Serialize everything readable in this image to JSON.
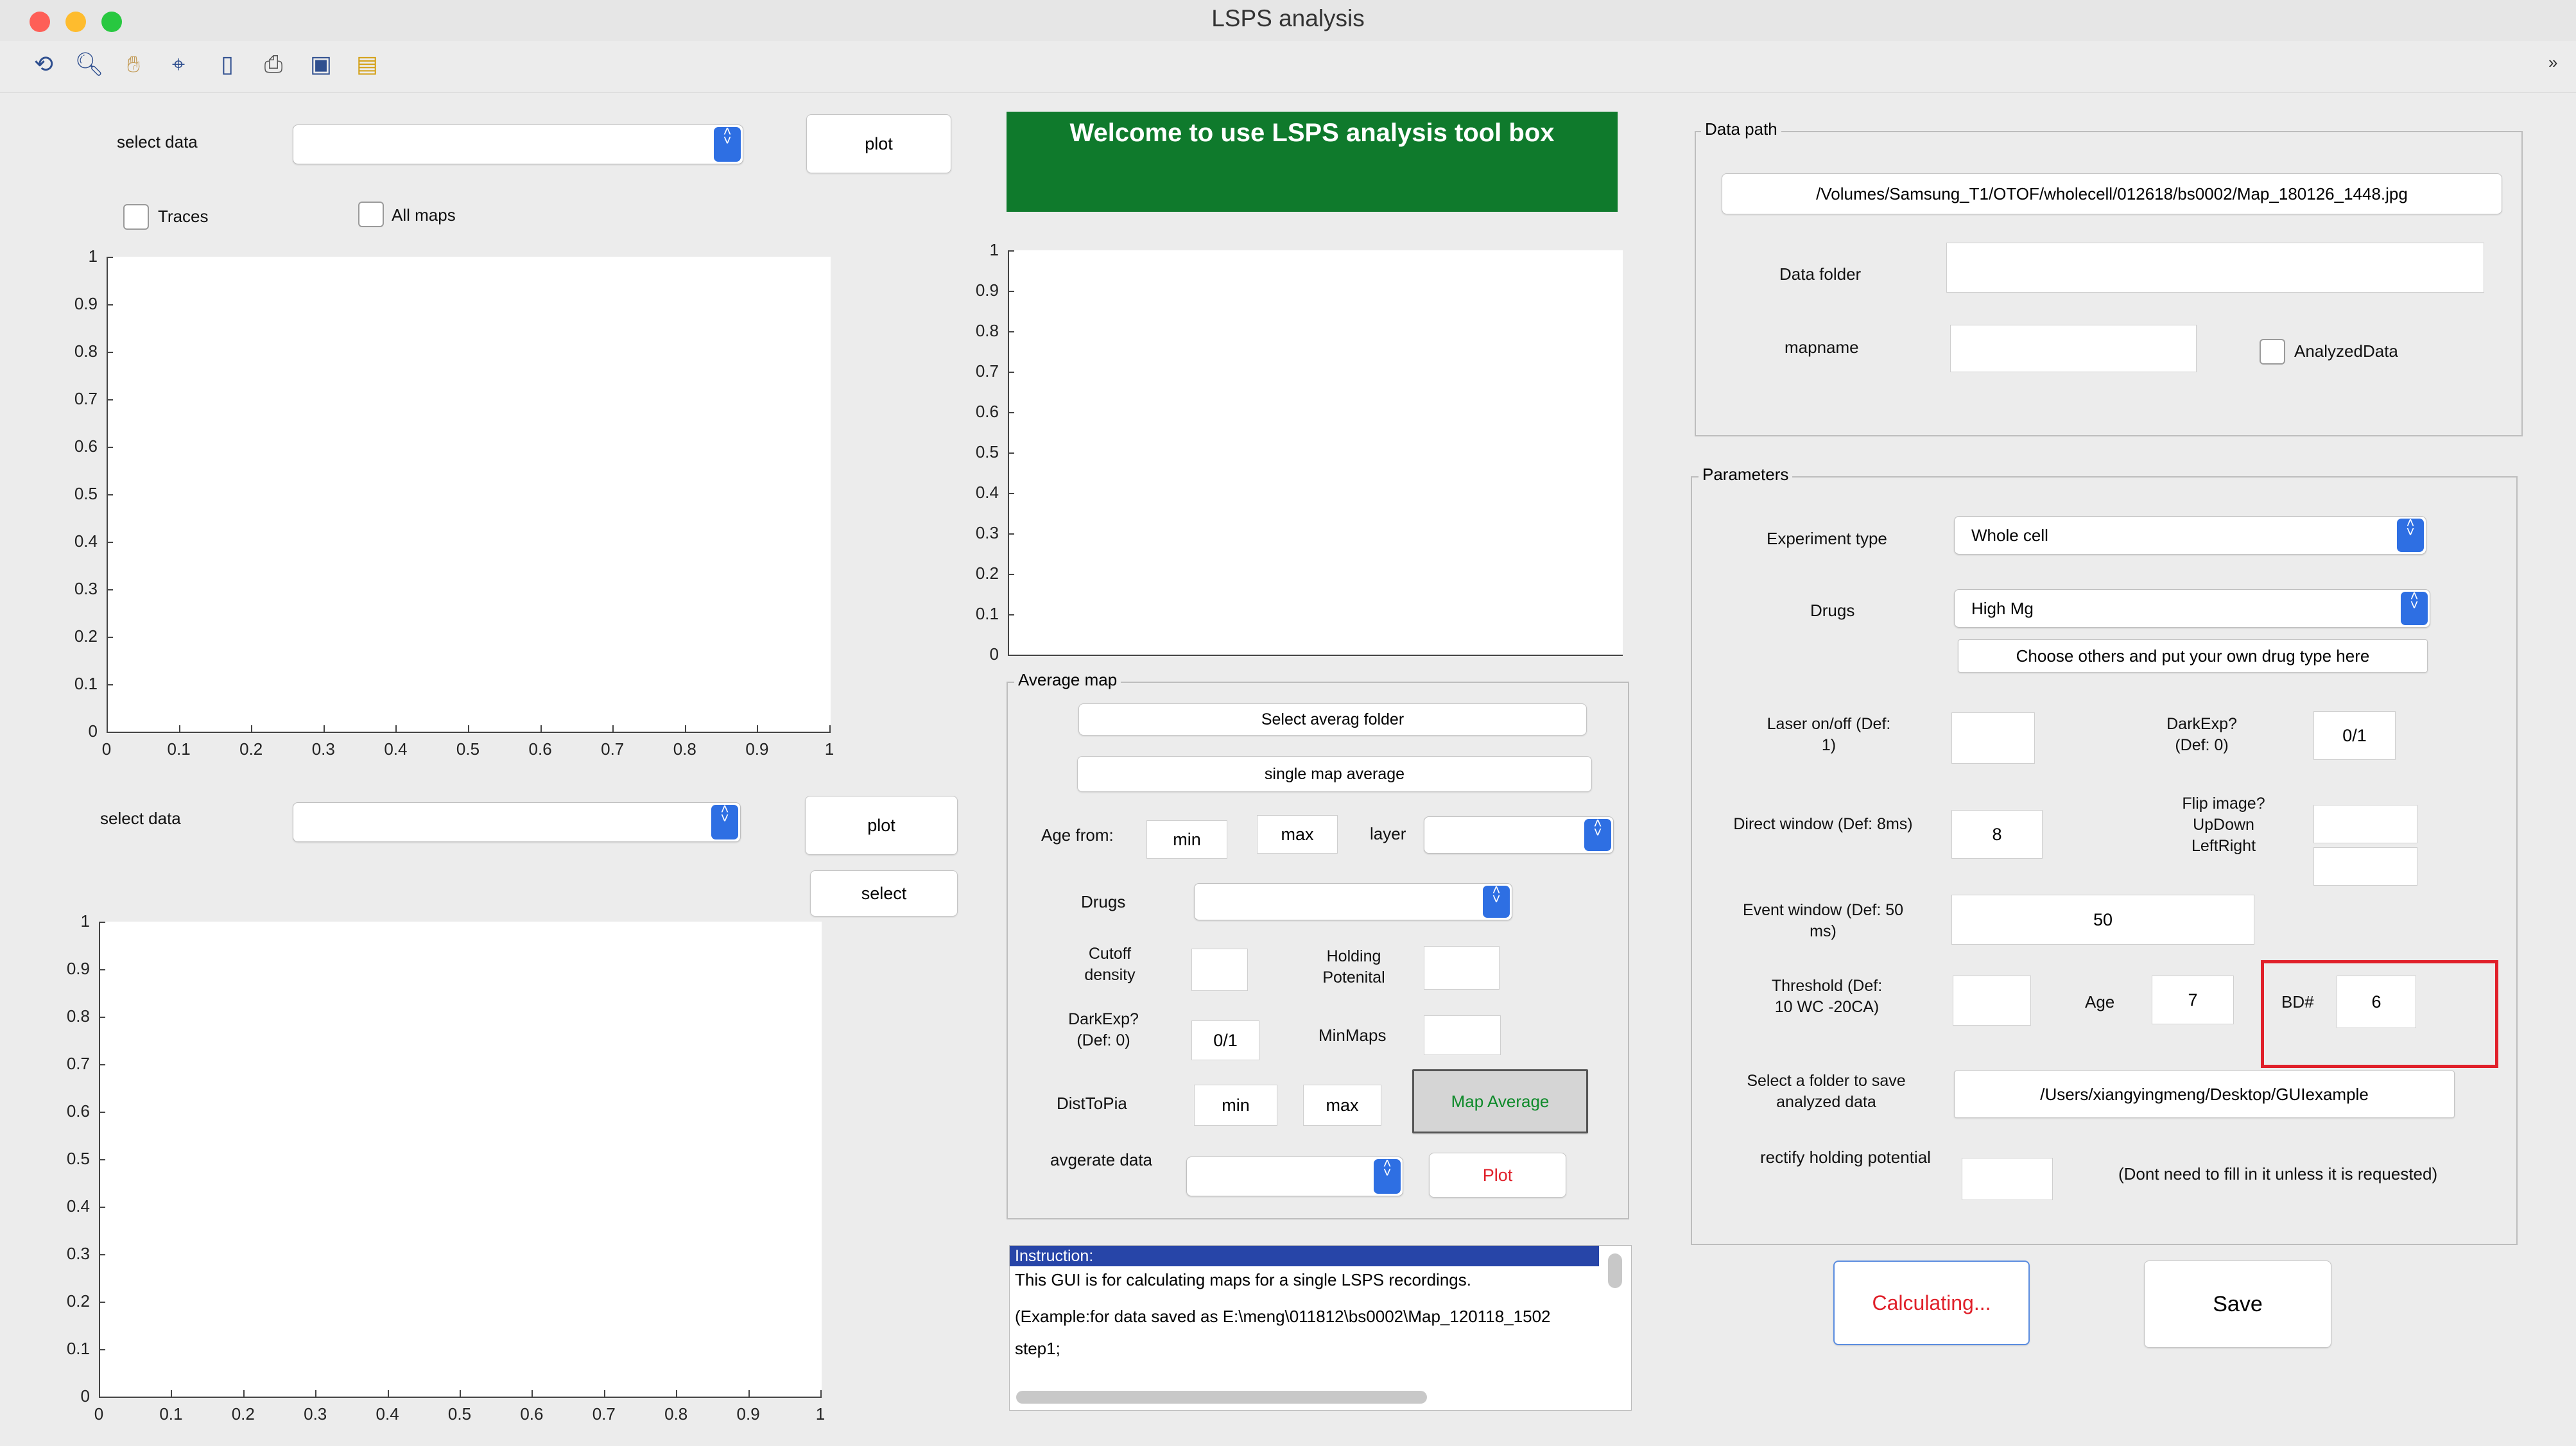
{
  "window": {
    "title": "LSPS analysis"
  },
  "toolbar": {
    "icons": [
      "rotate-3d-icon",
      "zoom-icon",
      "pan-hand-icon",
      "data-cursor-icon",
      "colorbar-icon",
      "print-icon",
      "save-icon",
      "open-folder-icon"
    ]
  },
  "colors": {
    "welcome_bg": "#0f7a2c",
    "highlight_red": "#e0202a",
    "plot_text": "#e0202a",
    "map_average_text": "#0e8a2a",
    "calc_border": "#5b8de0"
  },
  "left": {
    "select_data_label": "select data",
    "plot_label": "plot",
    "traces_label": "Traces",
    "all_maps_label": "All maps",
    "select_data2_label": "select data",
    "plot2_label": "plot",
    "select_label": "select",
    "axes1": {
      "y_ticks": [
        "1",
        "0.9",
        "0.8",
        "0.7",
        "0.6",
        "0.5",
        "0.4",
        "0.3",
        "0.2",
        "0.1",
        "0"
      ],
      "x_ticks": [
        "0",
        "0.1",
        "0.2",
        "0.3",
        "0.4",
        "0.5",
        "0.6",
        "0.7",
        "0.8",
        "0.9",
        "1"
      ]
    },
    "axes2": {
      "y_ticks": [
        "1",
        "0.9",
        "0.8",
        "0.7",
        "0.6",
        "0.5",
        "0.4",
        "0.3",
        "0.2",
        "0.1",
        "0"
      ],
      "x_ticks": [
        "0",
        "0.1",
        "0.2",
        "0.3",
        "0.4",
        "0.5",
        "0.6",
        "0.7",
        "0.8",
        "0.9",
        "1"
      ]
    }
  },
  "middle": {
    "welcome": "Welcome to use LSPS analysis tool box",
    "axes": {
      "y_ticks": [
        "1",
        "0.9",
        "0.8",
        "0.7",
        "0.6",
        "0.5",
        "0.4",
        "0.3",
        "0.2",
        "0.1",
        "0"
      ]
    },
    "avg_map": {
      "title": "Average map",
      "select_folder": "Select averag folder",
      "single_map": "single map average",
      "age_from": "Age from:",
      "age_min": "min",
      "age_max": "max",
      "layer": "layer",
      "drugs": "Drugs",
      "cutoff_density": "Cutoff density",
      "holding_potential": "Holding Potenital",
      "darkexp": "DarkExp? (Def: 0)",
      "darkexp_value": "0/1",
      "minmaps": "MinMaps",
      "disttopia": "DistToPia",
      "dist_min": "min",
      "dist_max": "max",
      "map_average": "Map Average",
      "avg_data": "avgerate data",
      "plot": "Plot"
    },
    "instruction": {
      "header": "Instruction:",
      "lines": [
        "This GUI is for calculating maps for a single LSPS recordings.",
        "(Example:for data saved as E:\\meng\\011812\\bs0002\\Map_120118_1502",
        "step1;"
      ]
    }
  },
  "right": {
    "data_path": {
      "title": "Data path",
      "path": "/Volumes/Samsung_T1/OTOF/wholecell/012618/bs0002/Map_180126_1448.jpg",
      "data_folder_label": "Data folder",
      "mapname_label": "mapname",
      "analyzed_label": "AnalyzedData"
    },
    "parameters": {
      "title": "Parameters",
      "experiment_type_label": "Experiment type",
      "experiment_type_value": "Whole cell",
      "drugs_label": "Drugs",
      "drugs_value": "High Mg",
      "choose_others": "Choose others and put your own drug type here",
      "laser_label": "Laser on/off (Def: 1)",
      "darkexp_label": "DarkExp? (Def: 0)",
      "darkexp_value": "0/1",
      "direct_window_label": "Direct window (Def: 8ms)",
      "direct_window_value": "8",
      "flip_label": "Flip image? UpDown LeftRight",
      "event_window_label": "Event window (Def: 50 ms)",
      "event_window_value": "50",
      "threshold_label": "Threshold (Def: 10 WC -20CA)",
      "age_label": "Age",
      "age_value": "7",
      "bd_label": "BD#",
      "bd_value": "6",
      "save_folder_label": "Select a folder to save analyzed data",
      "save_folder_value": "/Users/xiangyingmeng/Desktop/GUIexample",
      "rectify_label": "rectify holding potential",
      "rectify_note": "(Dont need to fill in it unless it is requested)"
    },
    "calculating": "Calculating...",
    "save": "Save"
  }
}
